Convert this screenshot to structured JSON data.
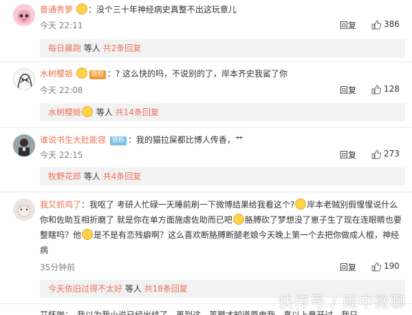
{
  "comments": [
    {
      "user": "普通秀萝",
      "badge": "",
      "text": "没个三十年神经病史真整不出这玩意儿",
      "time": "今天 22:11",
      "reply_label": "回复",
      "likes": "386",
      "replies": {
        "names": "每日晨跑",
        "middle": " 等人 ",
        "count_text": "共2条回复"
      }
    },
    {
      "user": "水树樱姬",
      "badge": "铁粉",
      "text": "? 这么快的吗，不说别的了，岸本齐史我鲨了你",
      "time": "今天 22:08",
      "reply_label": "回复",
      "likes": "128",
      "replies": {
        "names": "水树樱姬",
        "middle": " 等人 ",
        "count_text": "共14条回复"
      }
    },
    {
      "user": "谁说书生大肚能容",
      "badge": "铁粉",
      "text": "我的猫拉屎都比博人传香，艹",
      "time": "今天 22:15",
      "reply_label": "回复",
      "likes": "273",
      "replies": {
        "names": "牧野花郎",
        "middle": " 等人 ",
        "count_text": "共4条回复"
      }
    },
    {
      "user": "我又抓鸡了",
      "badge": "",
      "text_parts": [
        "我呕了 考研人忙碌一天睡前刷一下微博结果给我看这个?",
        "岸本老贼别假惺惺说什么你和佐助互相折磨了 就是你在单方面施虐佐助而已吧",
        "胳膊砍了梦想没了崽子生了现在连眼睛也要整瞎吗？他",
        "是不是有恋残癖啊？这么喜欢断胳膊断腿老娘今天晚上第一个去把你做成人棍，神经病"
      ],
      "time": "35分钟前",
      "reply_label": "回复",
      "likes": "190",
      "replies": {
        "names": "今天依旧过得不太好",
        "middle": " 等人 ",
        "count_text": "共18条回复"
      }
    }
  ],
  "cut_off_text": "艾怀咖：　我以为我小说已经出结了，再到这　英戳才知道原电我　真以上意开讨　我只",
  "watermark": "快传号 / 雨中微聊",
  "colors": {
    "username": "#eb7350",
    "reply_bg": "#f2f2f5",
    "time": "#808080"
  }
}
